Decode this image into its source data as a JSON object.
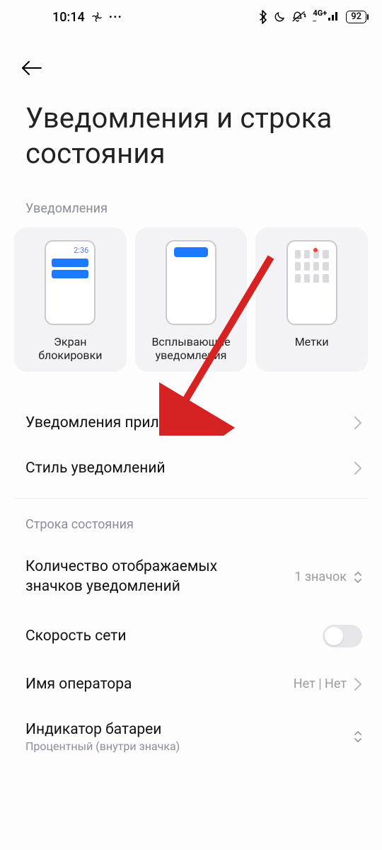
{
  "status": {
    "time": "10:14",
    "battery": "92",
    "network": "4G+"
  },
  "title": "Уведомления и строка состояния",
  "sections": {
    "notifications_label": "Уведомления",
    "statusbar_label": "Строка состояния"
  },
  "cards": {
    "lockscreen": {
      "label": "Экран\nблокировки",
      "time": "2:36"
    },
    "popup": {
      "label": "Всплывающие\nуведомления"
    },
    "badges": {
      "label": "Метки"
    }
  },
  "rows": {
    "app_notifications": "Уведомления приложений",
    "notification_style": "Стиль уведомлений",
    "icon_count": {
      "title": "Количество отображаемых значков уведомлений",
      "value": "1 значок"
    },
    "network_speed": "Скорость сети",
    "carrier_name": {
      "title": "Имя оператора",
      "value": "Нет | Нет"
    },
    "battery_indicator": {
      "title": "Индикатор батареи",
      "sub": "Процентный (внутри значка)"
    }
  }
}
